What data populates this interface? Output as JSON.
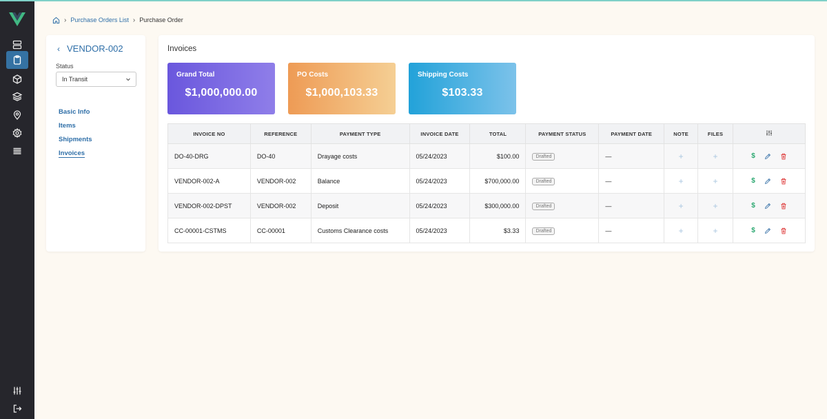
{
  "breadcrumb": {
    "list_link": "Purchase Orders List",
    "current": "Purchase Order"
  },
  "sidebar": {
    "icons": [
      "server-icon",
      "clipboard-icon",
      "box-icon",
      "layers-icon",
      "location-icon",
      "settings-icon",
      "list-icon"
    ],
    "active": "clipboard-icon",
    "bottom_icons": [
      "sliders-icon",
      "logout-icon"
    ]
  },
  "po": {
    "title": "VENDOR-002",
    "status_label": "Status",
    "status_value": "In Transit",
    "menu": [
      "Basic Info",
      "Items",
      "Shipments",
      "Invoices"
    ],
    "active_menu": "Invoices"
  },
  "invoices": {
    "title": "Invoices",
    "cards": [
      {
        "label": "Grand Total",
        "value": "$1,000,000.00",
        "color": "#6a57dd"
      },
      {
        "label": "PO Costs",
        "value": "$1,000,103.33",
        "color": "#ee9b55"
      },
      {
        "label": "Shipping Costs",
        "value": "$103.33",
        "color": "#22a2d9"
      }
    ],
    "columns": [
      "INVOICE NO",
      "REFERENCE",
      "PAYMENT TYPE",
      "INVOICE DATE",
      "TOTAL",
      "PAYMENT STATUS",
      "PAYMENT DATE",
      "NOTE",
      "FILES"
    ],
    "rows": [
      {
        "invoice_no": "DO-40-DRG",
        "reference": "DO-40",
        "payment_type": "Drayage costs",
        "invoice_date": "05/24/2023",
        "total": "$100.00",
        "status": "Drafted",
        "payment_date": "—",
        "note": "+",
        "files": "+"
      },
      {
        "invoice_no": "VENDOR-002-A",
        "reference": "VENDOR-002",
        "payment_type": "Balance",
        "invoice_date": "05/24/2023",
        "total": "$700,000.00",
        "status": "Drafted",
        "payment_date": "—",
        "note": "+",
        "files": "+"
      },
      {
        "invoice_no": "VENDOR-002-DPST",
        "reference": "VENDOR-002",
        "payment_type": "Deposit",
        "invoice_date": "05/24/2023",
        "total": "$300,000.00",
        "status": "Drafted",
        "payment_date": "—",
        "note": "+",
        "files": "+"
      },
      {
        "invoice_no": "CC-00001-CSTMS",
        "reference": "CC-00001",
        "payment_type": "Customs Clearance costs",
        "invoice_date": "05/24/2023",
        "total": "$3.33",
        "status": "Drafted",
        "payment_date": "—",
        "note": "+",
        "files": "+"
      }
    ],
    "row_action_dollar": "$"
  }
}
